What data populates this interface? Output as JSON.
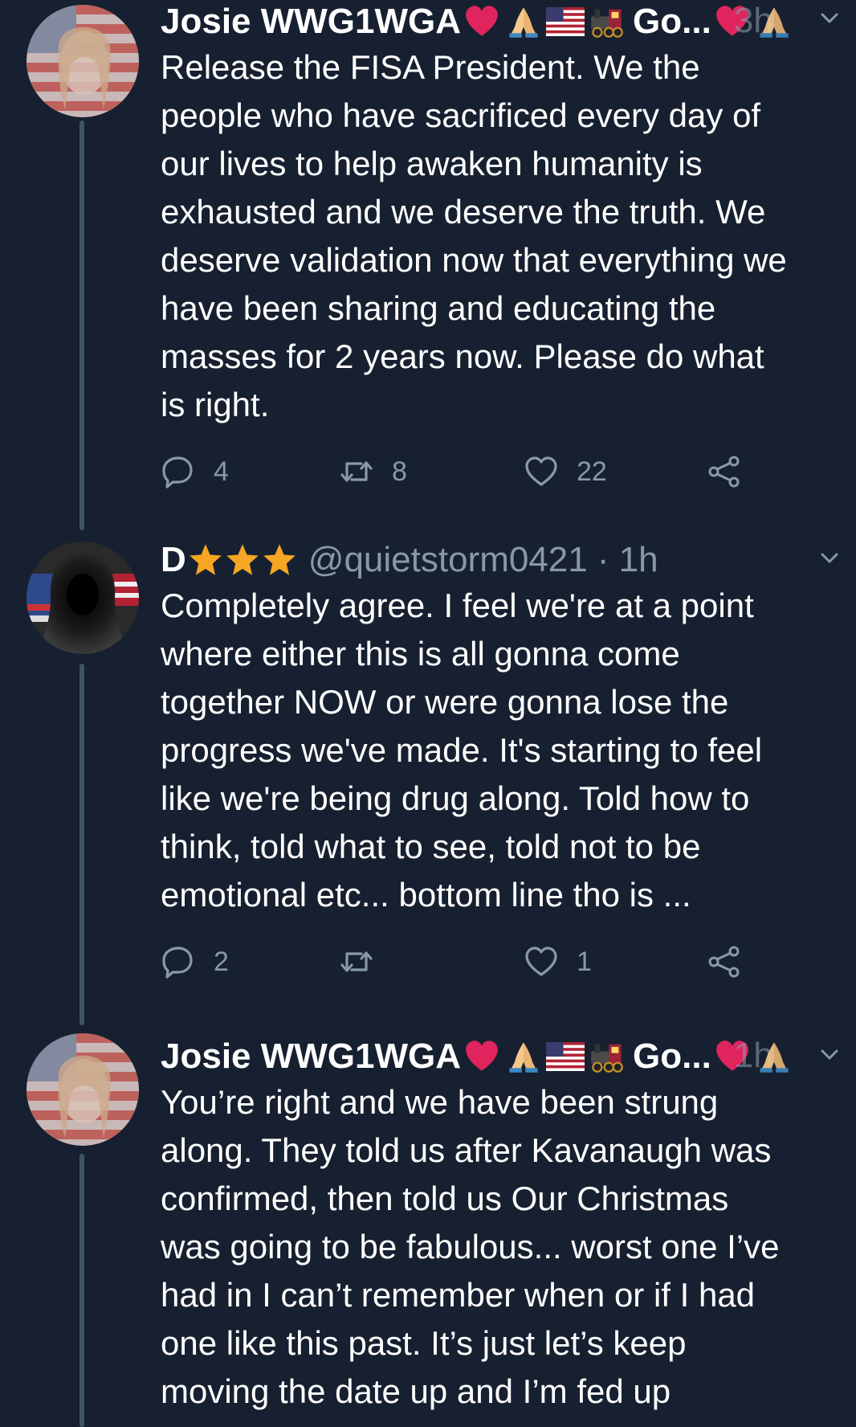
{
  "tweets": [
    {
      "name": "Josie WWG1WGA",
      "name_suffix": "Go...",
      "time_partial": "3h",
      "text": "Release the FISA President. We the\npeople who have sacrificed every day of\nour lives to help awaken humanity is\nexhausted and we deserve the truth. We\ndeserve validation now that everything we\nhave been sharing and educating the\nmasses for 2 years now. Please do what\nis right.",
      "replies": "4",
      "retweets": "8",
      "likes": "22",
      "avatar": "flag-portrait-woman"
    },
    {
      "name": "D",
      "stars": 3,
      "handle": "@quietstorm0421",
      "time": "· 1h",
      "text": "Completely agree.  I feel we're at a point\nwhere either this is all gonna come\ntogether NOW or were gonna lose the\nprogress we've made.  It's starting to feel\nlike we're being drug along. Told how to\nthink, told what to see, told not to be\nemotional etc... bottom line tho is ...",
      "replies": "2",
      "retweets": "",
      "likes": "1",
      "avatar": "hooded-figure-flag"
    },
    {
      "name": "Josie WWG1WGA",
      "name_suffix": "Go...",
      "time_partial": "1h",
      "text": "You’re right and we have been strung\nalong. They told us after Kavanaugh was\nconfirmed, then told us Our Christmas\nwas going to be fabulous... worst one I’ve\nhad in I can’t remember when or if I had\none like this past. It’s just let’s keep\nmoving the date up and I’m fed up",
      "avatar": "flag-portrait-woman"
    }
  ],
  "colors": {
    "background": "#172030",
    "text": "#ffffff",
    "muted": "#8899a6",
    "thread_line": "#3d5466",
    "star": "#f5a623",
    "heart": "#e0245e"
  },
  "icons": [
    "reply-icon",
    "retweet-icon",
    "like-icon",
    "share-icon",
    "chevron-down-icon",
    "star-icon",
    "heart-emoji",
    "praying-hands-emoji",
    "us-flag-emoji",
    "locomotive-emoji"
  ]
}
